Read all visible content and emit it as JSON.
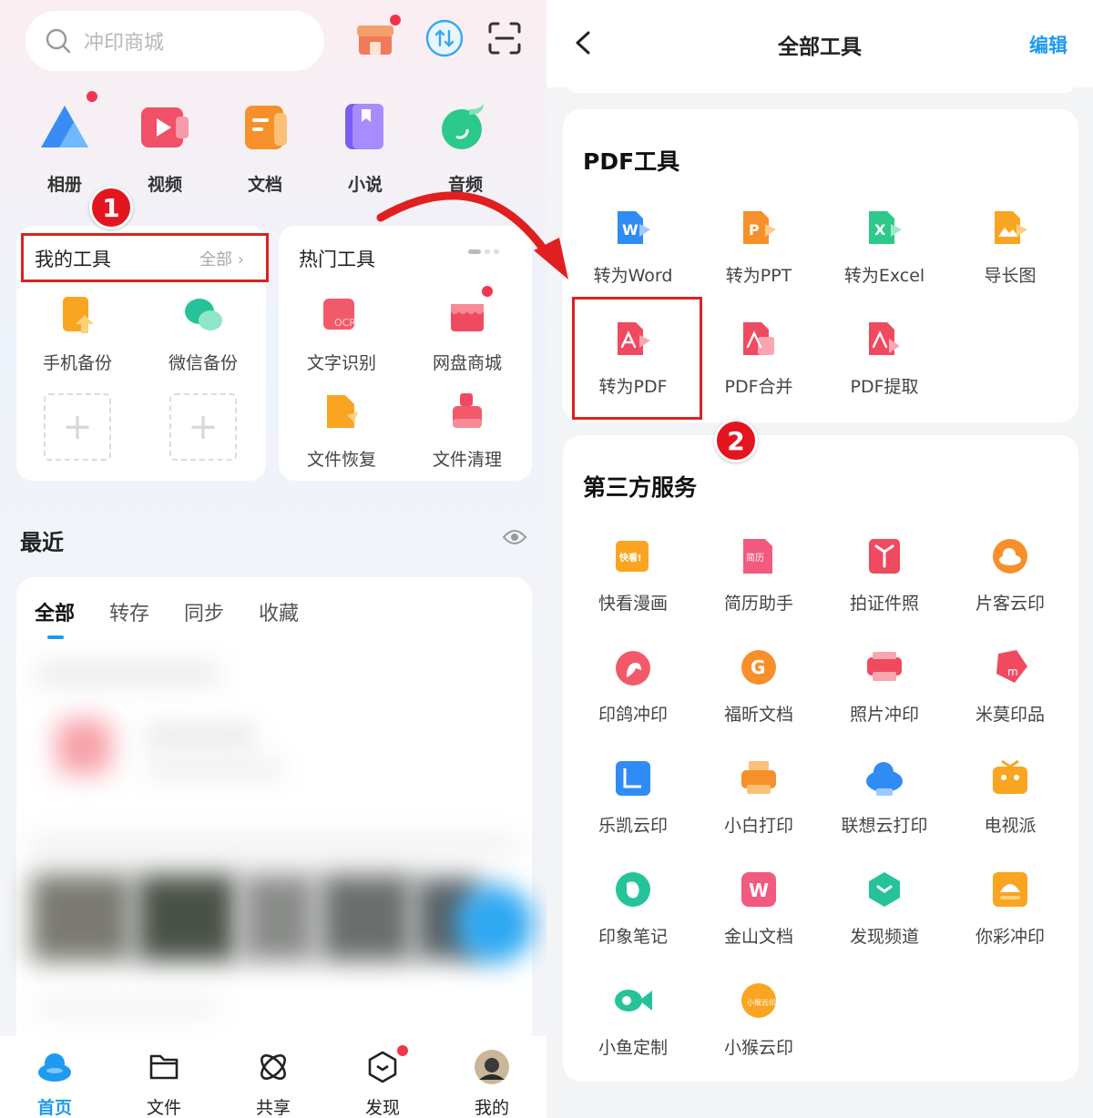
{
  "left": {
    "search_placeholder": "冲印商城",
    "quick_items": [
      {
        "label": "相册",
        "icon": "album-icon"
      },
      {
        "label": "视频",
        "icon": "video-icon"
      },
      {
        "label": "文档",
        "icon": "document-icon"
      },
      {
        "label": "小说",
        "icon": "novel-icon"
      },
      {
        "label": "音频",
        "icon": "audio-icon"
      }
    ],
    "my_tools": {
      "title": "我的工具",
      "all_link": "全部",
      "items": [
        {
          "label": "手机备份",
          "icon": "phone-backup-icon"
        },
        {
          "label": "微信备份",
          "icon": "wechat-backup-icon"
        }
      ],
      "add_symbol": "+"
    },
    "hot_tools": {
      "title": "热门工具",
      "items": [
        {
          "label": "文字识别",
          "icon": "ocr-icon",
          "icon_text": "OCR"
        },
        {
          "label": "网盘商城",
          "icon": "netdisk-store-icon"
        },
        {
          "label": "文件恢复",
          "icon": "file-recovery-icon"
        },
        {
          "label": "文件清理",
          "icon": "file-cleanup-icon"
        }
      ]
    },
    "recent": {
      "title": "最近",
      "tabs": [
        "全部",
        "转存",
        "同步",
        "收藏"
      ],
      "active_tab": "全部"
    },
    "bottom_nav": [
      {
        "label": "首页",
        "icon": "home-cloud-icon",
        "active": true
      },
      {
        "label": "文件",
        "icon": "folder-icon"
      },
      {
        "label": "共享",
        "icon": "share-icon"
      },
      {
        "label": "发现",
        "icon": "discover-icon"
      },
      {
        "label": "我的",
        "icon": "avatar"
      }
    ],
    "step_badge": "1"
  },
  "right": {
    "title": "全部工具",
    "edit": "编辑",
    "pdf_section": {
      "title": "PDF工具",
      "items": [
        {
          "label": "转为Word",
          "icon": "to-word-icon",
          "icon_text": "W"
        },
        {
          "label": "转为PPT",
          "icon": "to-ppt-icon",
          "icon_text": "P"
        },
        {
          "label": "转为Excel",
          "icon": "to-excel-icon",
          "icon_text": "X"
        },
        {
          "label": "导长图",
          "icon": "long-image-icon"
        },
        {
          "label": "转为PDF",
          "icon": "to-pdf-icon"
        },
        {
          "label": "PDF合并",
          "icon": "pdf-merge-icon"
        },
        {
          "label": "PDF提取",
          "icon": "pdf-extract-icon"
        }
      ]
    },
    "third_party": {
      "title": "第三方服务",
      "items": [
        {
          "label": "快看漫画",
          "icon": "kuaikan-icon",
          "icon_text": "快看!"
        },
        {
          "label": "简历助手",
          "icon": "resume-icon",
          "icon_text": "简历"
        },
        {
          "label": "拍证件照",
          "icon": "id-photo-icon"
        },
        {
          "label": "片客云印",
          "icon": "pianke-icon"
        },
        {
          "label": "印鸽冲印",
          "icon": "yinge-icon"
        },
        {
          "label": "福昕文档",
          "icon": "foxit-icon",
          "icon_text": "G"
        },
        {
          "label": "照片冲印",
          "icon": "photo-print-icon"
        },
        {
          "label": "米莫印品",
          "icon": "mimo-icon",
          "icon_text": "m"
        },
        {
          "label": "乐凯云印",
          "icon": "lekai-icon"
        },
        {
          "label": "小白打印",
          "icon": "xiaobai-print-icon"
        },
        {
          "label": "联想云打印",
          "icon": "lenovo-print-icon"
        },
        {
          "label": "电视派",
          "icon": "tv-icon"
        },
        {
          "label": "印象笔记",
          "icon": "evernote-icon"
        },
        {
          "label": "金山文档",
          "icon": "kdocs-icon",
          "icon_text": "W"
        },
        {
          "label": "发现频道",
          "icon": "discover-channel-icon"
        },
        {
          "label": "你彩冲印",
          "icon": "nicai-icon"
        },
        {
          "label": "小鱼定制",
          "icon": "fish-icon"
        },
        {
          "label": "小猴云印",
          "icon": "monkey-print-icon",
          "icon_text": "小猴云印"
        }
      ]
    },
    "step_badge": "2"
  },
  "colors": {
    "accent": "#1e9af0",
    "highlight": "#e02020",
    "notification": "#f0364f"
  }
}
